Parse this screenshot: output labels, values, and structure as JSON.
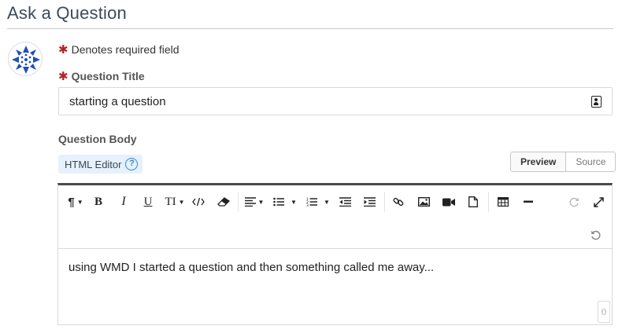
{
  "page": {
    "title": "Ask a Question"
  },
  "form": {
    "required_note": "Denotes required field",
    "question_title_label": "Question Title",
    "question_title_value": "starting a question",
    "question_body_label": "Question Body",
    "html_editor_label": "HTML Editor",
    "help_glyph": "?",
    "asterisk": "✱"
  },
  "mode_toggle": {
    "preview_label": "Preview",
    "source_label": "Source",
    "active": "Preview"
  },
  "editor": {
    "body_text": "using WMD I started a question and then something called me away...",
    "char_counter": "0",
    "toolbar": {
      "paragraph": "¶",
      "bold": "B",
      "italic": "I",
      "underline": "U",
      "font_size": "TI",
      "icons": [
        "paragraph-icon",
        "bold-icon",
        "italic-icon",
        "underline-icon",
        "font-size-icon",
        "code-icon",
        "eraser-icon",
        "align-icon",
        "bullet-list-icon",
        "numbered-list-icon",
        "outdent-icon",
        "indent-icon",
        "link-icon",
        "image-icon",
        "video-icon",
        "file-icon",
        "table-icon",
        "horizontal-rule-icon",
        "redo-icon",
        "fullscreen-icon",
        "undo-icon"
      ]
    }
  },
  "colors": {
    "required_asterisk": "#b32424",
    "accent_blue": "#2a8ad6",
    "editor_top_border": "#4a4a4a",
    "avatar_blue": "#1f4fb4"
  }
}
